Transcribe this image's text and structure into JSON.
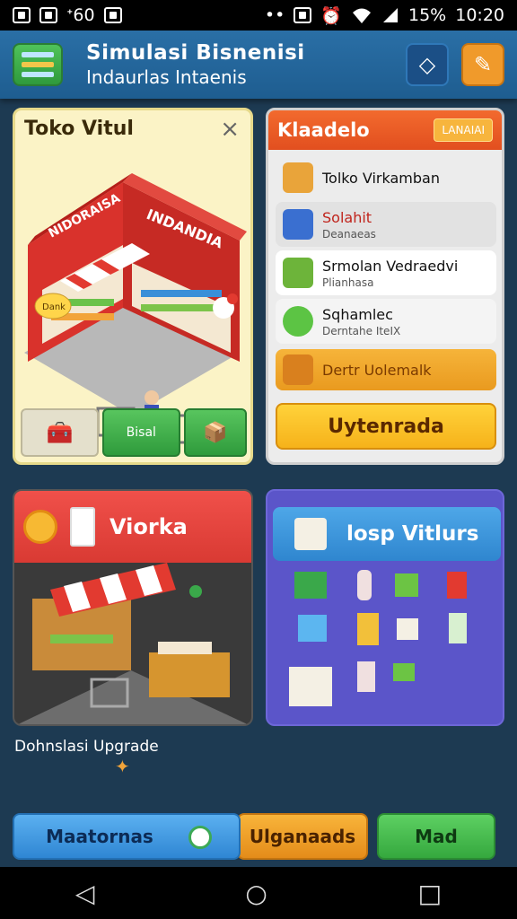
{
  "status": {
    "battery": "15%",
    "time": "10:20",
    "left_text": "ᐩ60"
  },
  "appbar": {
    "title": "Simulasi Bisnenisi",
    "subtitle": "Indaurlas Intaenis"
  },
  "panel_store": {
    "title": "Toko Vitul",
    "sign_1": "NIDORAISA",
    "sign_2": "INDANDIA",
    "bubble": "Dank",
    "tiles": [
      "",
      "Bisal",
      ""
    ]
  },
  "panel_menu": {
    "header": "Klaadelo",
    "badge": "LANAIAI",
    "rows": [
      {
        "title": "Tolko Virkamban",
        "sub": "",
        "color": "#e9a43a"
      },
      {
        "title": "Solahit",
        "sub": "Deanaeas",
        "color": "#3a6fd0"
      },
      {
        "title": "Srmolan Vedraedvi",
        "sub": "Plianhasa",
        "color": "#6db43a"
      },
      {
        "title": "Sqhamlec",
        "sub": "Derntahe IteIX",
        "color": "#5cc444"
      },
      {
        "title": "Dertr Uolemalk",
        "sub": "",
        "color": "#e59a2b"
      }
    ],
    "cta": "Uytenrada"
  },
  "panel_shop": {
    "title": "Viorka"
  },
  "panel_items": {
    "title": "losp Vitlurs"
  },
  "upgrade_label": "Dohnslasi Upgrade",
  "bottom_buttons": {
    "b1": "Maatornas",
    "b2": "Ulganaads",
    "b3": "Mad"
  }
}
